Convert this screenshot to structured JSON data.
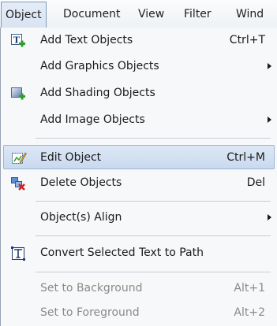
{
  "menubar": {
    "items": [
      "Object",
      "Document",
      "View",
      "Filter",
      "Wind"
    ],
    "active_index": 0
  },
  "menu": {
    "items": [
      {
        "label": "Add Text Objects",
        "shortcut": "Ctrl+T",
        "icon": "add-text-object-icon"
      },
      {
        "label": "Add Graphics Objects",
        "submenu": true
      },
      {
        "label": "Add Shading Objects",
        "icon": "add-shading-object-icon"
      },
      {
        "label": "Add Image Objects",
        "submenu": true
      },
      {
        "label": "Edit Object",
        "shortcut": "Ctrl+M",
        "icon": "edit-object-icon",
        "highlighted": true
      },
      {
        "label": "Delete Objects",
        "shortcut": "Del",
        "icon": "delete-objects-icon"
      },
      {
        "label": "Object(s) Align",
        "submenu": true
      },
      {
        "label": "Convert Selected Text to Path",
        "icon": "text-to-path-icon"
      },
      {
        "label": "Set to Background",
        "shortcut": "Alt+1",
        "disabled": true
      },
      {
        "label": "Set to Foreground",
        "shortcut": "Alt+2",
        "disabled": true
      }
    ]
  },
  "colors": {
    "accent_highlight": "#c9d9ee",
    "disabled_text": "#8a8a8a",
    "icon_green": "#2e9d2e",
    "icon_red": "#d32020"
  }
}
